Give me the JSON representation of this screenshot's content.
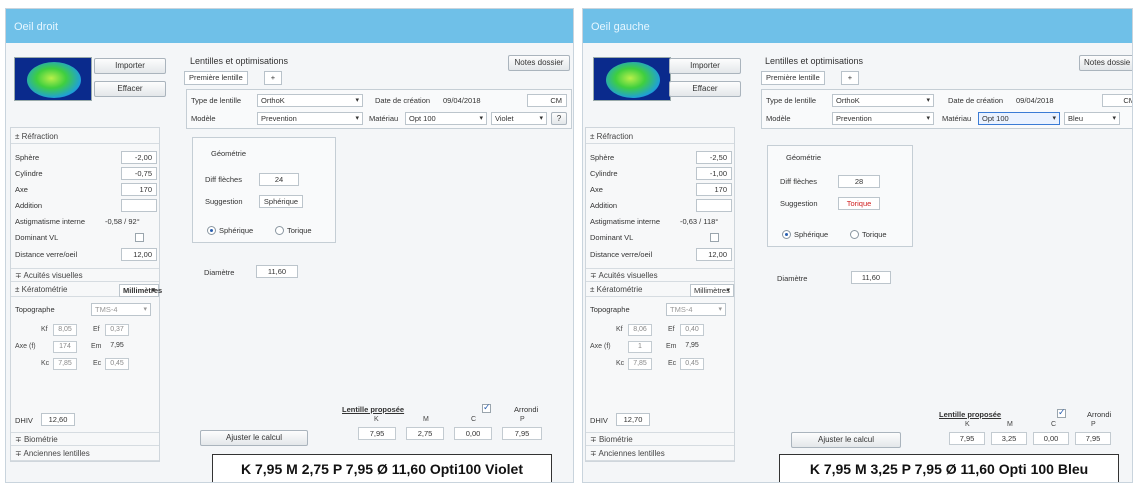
{
  "right": {
    "title": "Oeil droit",
    "import_label": "Importer",
    "erase_label": "Effacer",
    "lens_header": "Lentilles et optimisations",
    "notes_label": "Notes dossier",
    "first_lens_tab": "Première lentille",
    "plus": "+",
    "lens_type_label": "Type de lentille",
    "lens_type_value": "OrthoK",
    "creation_label": "Date de création",
    "creation_value": "09/04/2018",
    "cm": "CM",
    "model_label": "Modèle",
    "model_value": "Prevention",
    "material_label": "Matériau",
    "material_value": "Opt 100",
    "color_value": "Violet",
    "help": "?",
    "refraction_head": "Réfraction",
    "sphere_label": "Sphère",
    "sphere_value": "-2,00",
    "cylinder_label": "Cylindre",
    "cylinder_value": "-0,75",
    "axis_label": "Axe",
    "axis_value": "170",
    "addition_label": "Addition",
    "addition_value": "",
    "astig_label": "Astigmatisme interne",
    "astig_value": "-0,58 / 92°",
    "dominant_label": "Dominant VL",
    "distance_label": "Distance verre/oeil",
    "distance_value": "12,00",
    "acuity_head": "Acuités visuelles",
    "kerato_head": "Kératométrie",
    "kerato_unit": "Millimètres",
    "topo_label": "Topographe",
    "topo_value": "TMS-4",
    "kf_label": "Kf",
    "kf_value": "8,05",
    "ef_label": "Ef",
    "ef_value": "0,37",
    "axis_f_label": "Axe (f)",
    "axis_f_value": "174",
    "em_label": "Em",
    "em_value": "7,95",
    "kc_label": "Kc",
    "kc_value": "7,85",
    "ec_label": "Ec",
    "ec_value": "0,45",
    "dhiv_label": "DHIV",
    "dhiv_value": "12,60",
    "biometry_head": "Biométrie",
    "old_lens_head": "Anciennes lentilles",
    "geometry_label": "Géométrie",
    "diff_label": "Diff flèches",
    "diff_value": "24",
    "suggest_label": "Suggestion",
    "suggest_value": "Sphérique",
    "spherical_label": "Sphérique",
    "toric_label": "Torique",
    "diameter_label": "Diamètre",
    "diameter_value": "11,60",
    "proposed_label": "Lentille proposée",
    "rounded_label": "Arrondi",
    "col_k": "K",
    "col_m": "M",
    "col_c": "C",
    "col_p": "P",
    "k": "7,95",
    "m": "2,75",
    "c": "0,00",
    "p": "7,95",
    "adjust_label": "Ajuster le calcul",
    "result": "K 7,95 M 2,75 P 7,95 Ø 11,60 Opti100 Violet"
  },
  "left": {
    "title": "Oeil gauche",
    "import_label": "Importer",
    "erase_label": "Effacer",
    "lens_header": "Lentilles et optimisations",
    "notes_label": "Notes dossie",
    "first_lens_tab": "Première lentille",
    "plus": "+",
    "lens_type_label": "Type de lentille",
    "lens_type_value": "OrthoK",
    "creation_label": "Date de création",
    "creation_value": "09/04/2018",
    "cm": "CM",
    "model_label": "Modèle",
    "model_value": "Prevention",
    "material_label": "Matériau",
    "material_value": "Opt 100",
    "color_value": "Bleu",
    "refraction_head": "Réfraction",
    "sphere_label": "Sphère",
    "sphere_value": "-2,50",
    "cylinder_label": "Cylindre",
    "cylinder_value": "-1,00",
    "axis_label": "Axe",
    "axis_value": "170",
    "addition_label": "Addition",
    "addition_value": "",
    "astig_label": "Astigmatisme interne",
    "astig_value": "-0,63 / 118°",
    "dominant_label": "Dominant VL",
    "distance_label": "Distance verre/oeil",
    "distance_value": "12,00",
    "acuity_head": "Acuités visuelles",
    "kerato_head": "Kératométrie",
    "kerato_unit": "Millimètres",
    "topo_label": "Topographe",
    "topo_value": "TMS-4",
    "kf_label": "Kf",
    "kf_value": "8,06",
    "ef_label": "Ef",
    "ef_value": "0,40",
    "axis_f_label": "Axe (f)",
    "axis_f_value": "1",
    "em_label": "Em",
    "em_value": "7,95",
    "kc_label": "Kc",
    "kc_value": "7,85",
    "ec_label": "Ec",
    "ec_value": "0,45",
    "dhiv_label": "DHIV",
    "dhiv_value": "12,70",
    "biometry_head": "Biométrie",
    "old_lens_head": "Anciennes lentilles",
    "geometry_label": "Géométrie",
    "diff_label": "Diff flèches",
    "diff_value": "28",
    "suggest_label": "Suggestion",
    "suggest_value": "Torique",
    "spherical_label": "Sphérique",
    "toric_label": "Torique",
    "diameter_label": "Diamètre",
    "diameter_value": "11,60",
    "proposed_label": "Lentille proposée",
    "rounded_label": "Arrondi",
    "col_k": "K",
    "col_m": "M",
    "col_c": "C",
    "col_p": "P",
    "k": "7,95",
    "m": "3,25",
    "c": "0,00",
    "p": "7,95",
    "adjust_label": "Ajuster le calcul",
    "result": "K 7,95 M 3,25 P 7,95 Ø 11,60 Opti 100 Bleu"
  },
  "icons": {
    "collapse": "collapse-icon",
    "expand": "expand-icon",
    "dropdown": "chevron-down-icon"
  },
  "colors": {
    "title_bar": "#6fc0e8",
    "suggest_toric": "#d02020"
  }
}
